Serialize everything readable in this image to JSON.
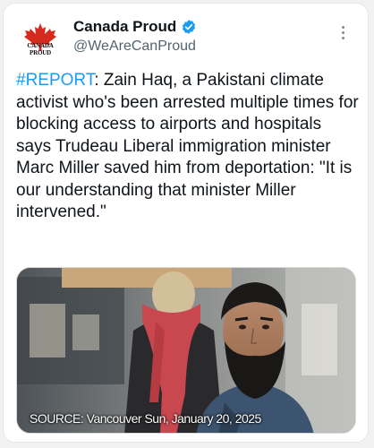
{
  "account": {
    "display_name": "Canada Proud",
    "handle": "@WeAreCanProud",
    "verified": true,
    "avatar_text": "CANADA PROUD",
    "avatar_icon": "maple-leaf-icon"
  },
  "tweet": {
    "hashtag": "#REPORT",
    "body": ": Zain Haq, a Pakistani climate activist who's been arrested multiple times for blocking access to airports and hospitals says Trudeau Liberal immigration minister Marc Miller saved him from deportation: \"It is our understanding that minister Miller intervened.\""
  },
  "media": {
    "caption": "SOURCE: Vancouver Sun, January 20, 2025"
  },
  "colors": {
    "link": "#1d9bf0",
    "verified": "#1d9bf0",
    "maple_leaf": "#d52b1e",
    "secondary_text": "#536471"
  }
}
